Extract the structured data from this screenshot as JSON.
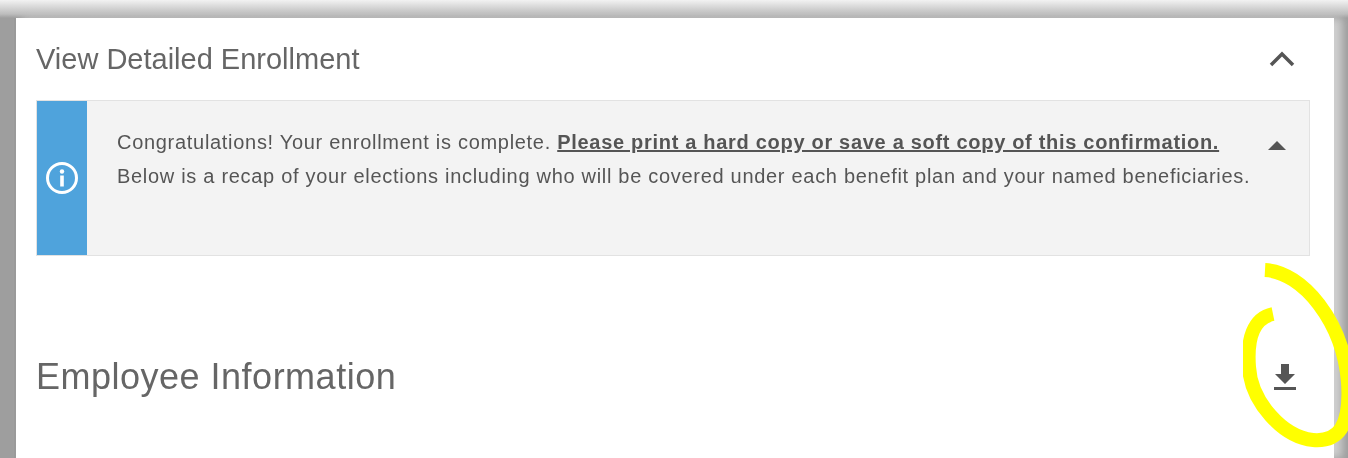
{
  "panel": {
    "title": "View Detailed Enrollment",
    "expanded": true
  },
  "alert": {
    "text": "Congratulations! Your enrollment is complete.",
    "link": "Please print a hard copy or save a soft copy of this confirmation.",
    "text_after": "Below is a recap of your elections including who will be covered under each benefit plan and your named beneficiaries.",
    "expanded": true
  },
  "section": {
    "title": "Employee Information"
  }
}
